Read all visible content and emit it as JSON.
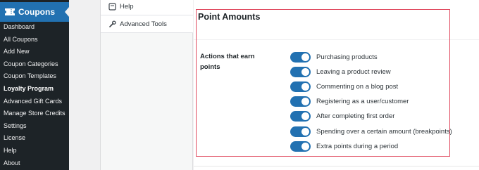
{
  "sidebar": {
    "menu_title": "Coupons",
    "items": [
      {
        "label": "Dashboard"
      },
      {
        "label": "All Coupons"
      },
      {
        "label": "Add New"
      },
      {
        "label": "Coupon Categories"
      },
      {
        "label": "Coupon Templates"
      },
      {
        "label": "Loyalty Program",
        "current": true
      },
      {
        "label": "Advanced Gift Cards"
      },
      {
        "label": "Manage Store Credits"
      },
      {
        "label": "Settings"
      },
      {
        "label": "License"
      },
      {
        "label": "Help"
      },
      {
        "label": "About"
      }
    ]
  },
  "tabs": {
    "help": {
      "label": "Help",
      "icon": "help-page-icon"
    },
    "advanced_tools": {
      "label": "Advanced Tools",
      "icon": "wrench-icon"
    }
  },
  "section": {
    "title": "Point Amounts",
    "field_label": "Actions that earn points",
    "actions": [
      {
        "label": "Purchasing products",
        "enabled": true
      },
      {
        "label": "Leaving a product review",
        "enabled": true
      },
      {
        "label": "Commenting on a blog post",
        "enabled": true
      },
      {
        "label": "Registering as a user/customer",
        "enabled": true
      },
      {
        "label": "After completing first order",
        "enabled": true
      },
      {
        "label": "Spending over a certain amount (breakpoints)",
        "enabled": true
      },
      {
        "label": "Extra points during a period",
        "enabled": true
      }
    ]
  },
  "colors": {
    "sidebar_bg": "#1d2327",
    "menu_active": "#2271b1",
    "toggle_on": "#2271b1",
    "highlight_border": "#e04a5f"
  }
}
